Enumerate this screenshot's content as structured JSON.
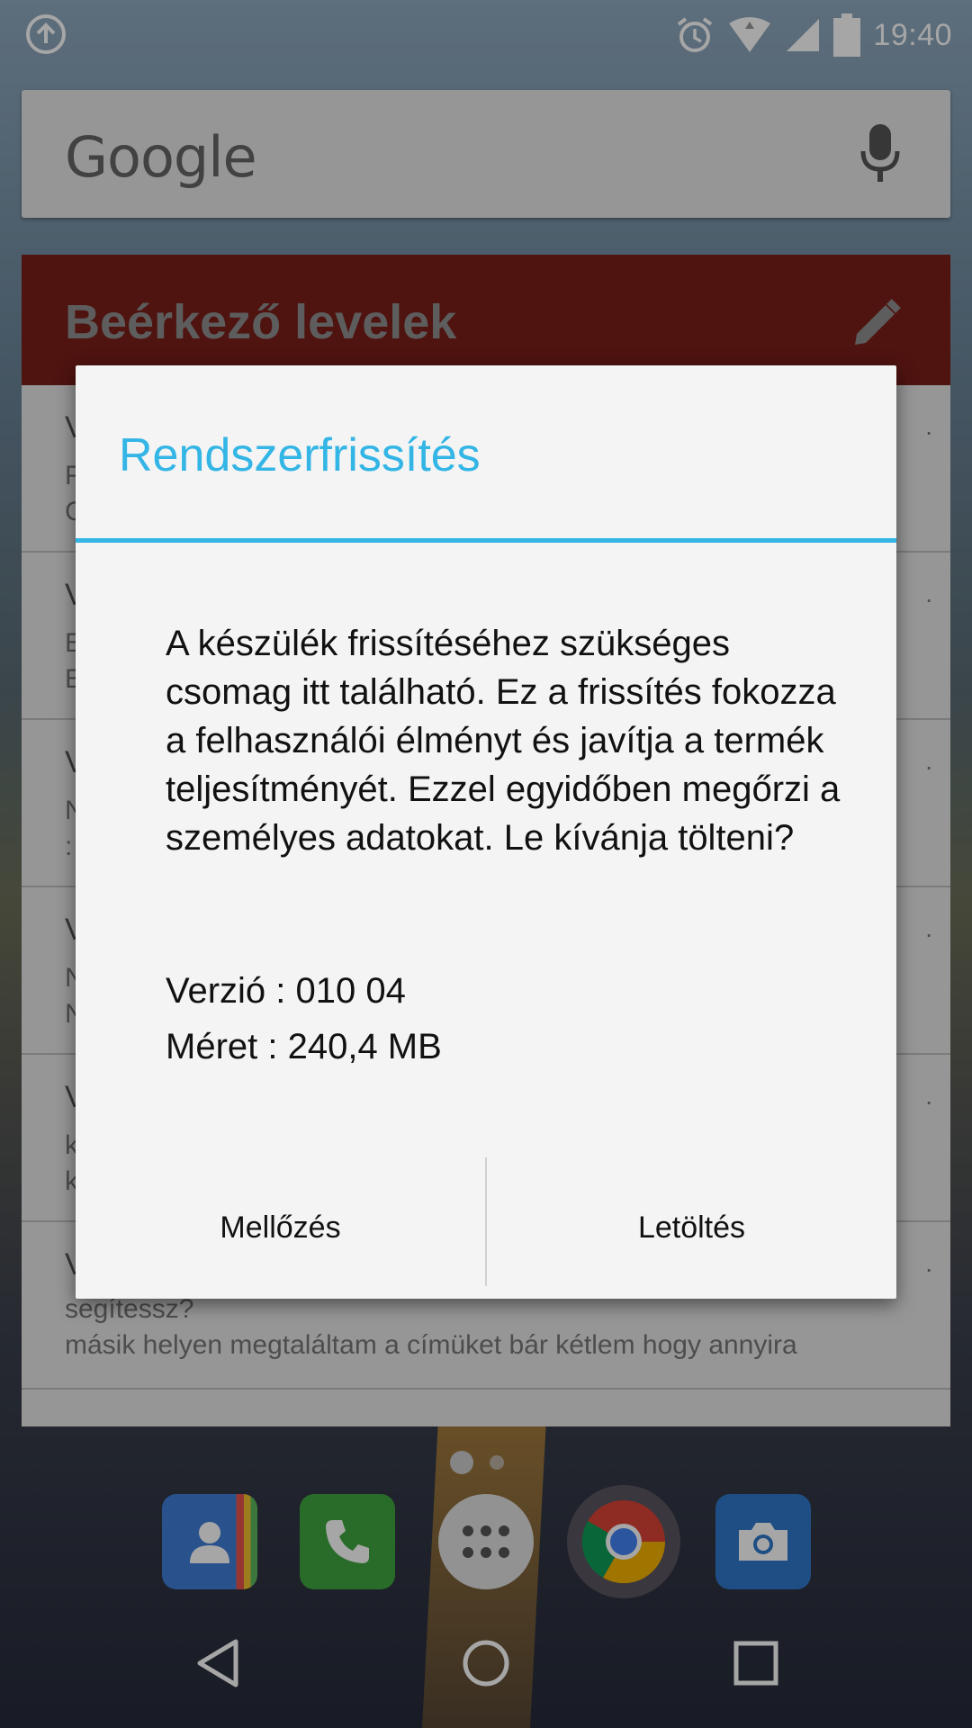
{
  "status_bar": {
    "time": "19:40",
    "icons": [
      "upload-icon",
      "alarm-icon",
      "wifi-icon",
      "signal-icon",
      "battery-icon"
    ]
  },
  "search_widget": {
    "logo_text": "Google",
    "icon": "mic-icon"
  },
  "gmail_widget": {
    "title": "Beérkező levelek",
    "icon": "pencil-icon",
    "rows": [
      {
        "l1": "V",
        "l2": "F",
        "l3": "C",
        "date": "."
      },
      {
        "l1": "V",
        "l2": "E",
        "l3": "E",
        "date": "."
      },
      {
        "l1": "V",
        "l2": "N",
        "l3": ":",
        "date": "."
      },
      {
        "l1": "V",
        "l2": "N",
        "l3": "N",
        "date": "."
      },
      {
        "l1": "V",
        "l2": "k",
        "l3": "k",
        "date": "."
      },
      {
        "l1": "V",
        "l2": "segítessz?",
        "l3": "másik helyen megtaláltam a címüket bár kétlem hogy annyira",
        "date": "."
      }
    ]
  },
  "dialog": {
    "title": "Rendszerfrissítés",
    "body": "A készülék frissítéséhez szükséges csomag itt található. Ez a frissítés fokozza a felhasználói élményt és javítja a termék teljesítményét. Ezzel egyidőben megőrzi a személyes adatokat. Le kívánja tölteni?",
    "version": "Verzió : 010 04",
    "size": "Méret : 240,4 MB",
    "dismiss_label": "Mellőzés",
    "download_label": "Letöltés"
  },
  "dock": {
    "apps": [
      "contacts-icon",
      "phone-icon",
      "app-drawer-icon",
      "chrome-icon",
      "camera-icon"
    ]
  },
  "nav_bar": {
    "icons": [
      "back-icon",
      "home-icon",
      "recents-icon"
    ]
  },
  "colors": {
    "accent": "#33b5e5",
    "gmail_header": "#7a1e1a"
  }
}
